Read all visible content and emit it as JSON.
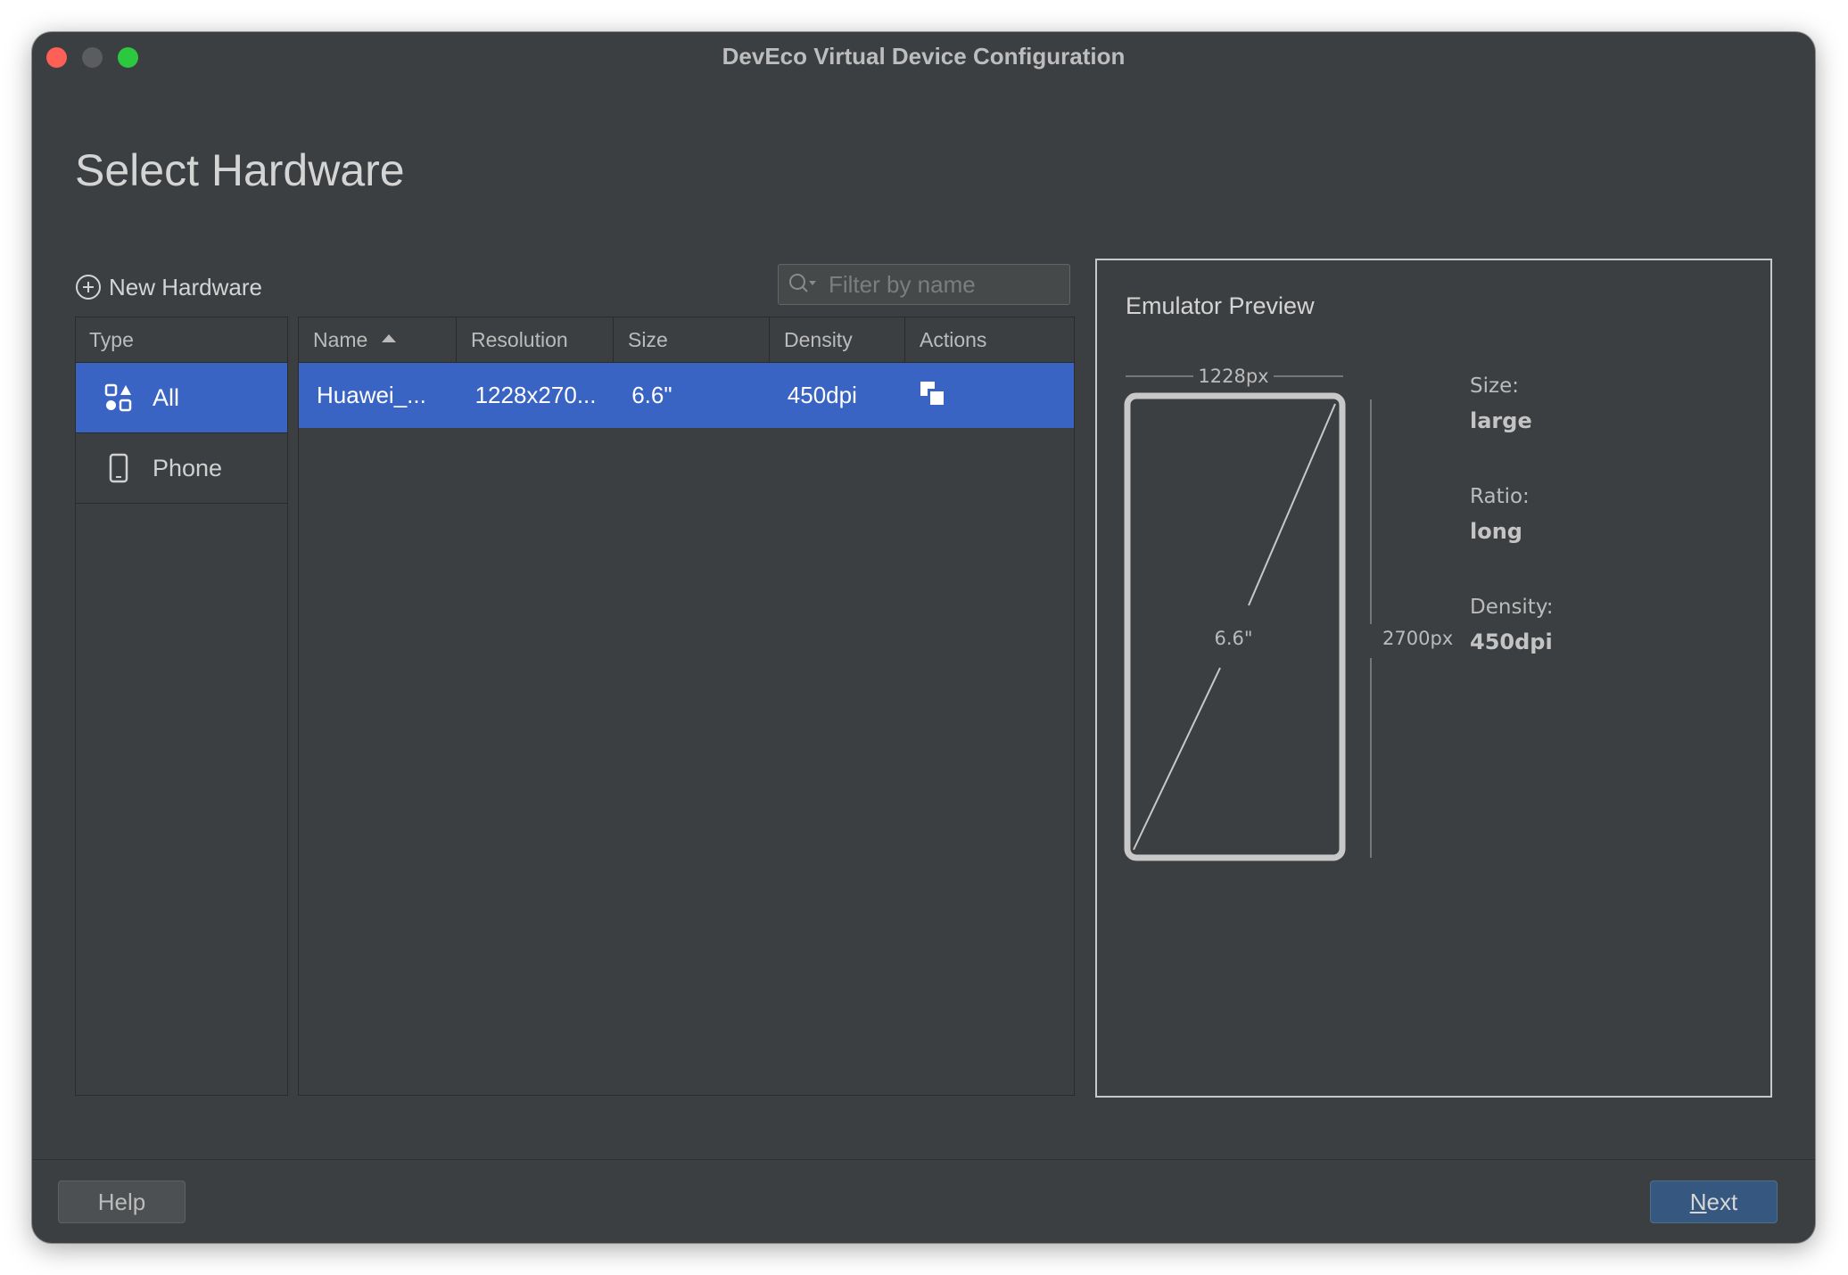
{
  "window": {
    "title": "DevEco Virtual Device Configuration"
  },
  "page": {
    "title": "Select Hardware"
  },
  "toolbar": {
    "new_hardware_label": "New Hardware"
  },
  "filter": {
    "placeholder": "Filter by name",
    "value": ""
  },
  "type_panel": {
    "header": "Type",
    "items": [
      {
        "label": "All",
        "icon": "category-grid-icon",
        "selected": true
      },
      {
        "label": "Phone",
        "icon": "phone-icon",
        "selected": false
      }
    ]
  },
  "table": {
    "columns": [
      "Name",
      "Resolution",
      "Size",
      "Density",
      "Actions"
    ],
    "sort": {
      "column": "Name",
      "direction": "ascending"
    },
    "rows": [
      {
        "name": "Huawei_...",
        "resolution": "1228x270...",
        "size": "6.6\"",
        "density": "450dpi",
        "action_icon": "clone-icon",
        "selected": true
      }
    ]
  },
  "preview": {
    "title": "Emulator Preview",
    "width_label": "1228px",
    "height_label": "2700px",
    "diagonal_label": "6.6\"",
    "specs": [
      {
        "label": "Size:",
        "value": "large"
      },
      {
        "label": "Ratio:",
        "value": "long"
      },
      {
        "label": "Density:",
        "value": "450dpi"
      }
    ]
  },
  "footer": {
    "help_label": "Help",
    "next_label_mnemonic": "N",
    "next_label_rest": "ext"
  },
  "colors": {
    "selection": "#3a64c4",
    "background": "#3c3f41",
    "next_button": "#365880"
  }
}
